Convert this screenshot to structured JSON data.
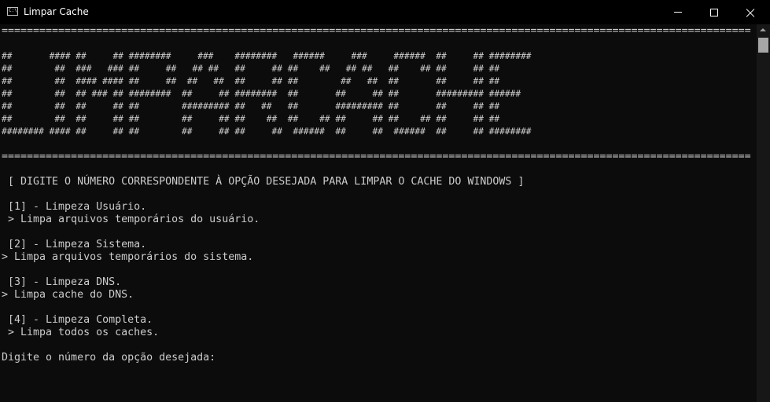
{
  "window": {
    "title": "Limpar Cache",
    "icon": "console-icon",
    "controls": {
      "minimize": "minimize-icon",
      "maximize": "maximize-icon",
      "close": "close-icon"
    }
  },
  "colors": {
    "background": "#0c0c0c",
    "text": "#cccccc",
    "titlebar": "#000000"
  },
  "console": {
    "separator_top": "=======================================================================================================================",
    "banner": [
      "##       #### ##     ## ########     ###    ########   ######     ###     ######  ##     ## ########",
      "##        ##  ###   ### ##     ##   ## ##   ##     ## ##    ##   ## ##   ##    ## ##     ## ##",
      "##        ##  #### #### ##     ##  ##   ##  ##     ## ##        ##   ##  ##       ##     ## ##",
      "##        ##  ## ### ## ########  ##     ## ########  ##       ##     ## ##       ######### ######",
      "##        ##  ##     ## ##        ######### ##   ##   ##       ######### ##       ##     ## ##",
      "##        ##  ##     ## ##        ##     ## ##    ##  ##    ## ##     ## ##    ## ##     ## ##",
      "######## #### ##     ## ##        ##     ## ##     ##  ######  ##     ##  ######  ##     ## ########"
    ],
    "separator_bottom": "=======================================================================================================================",
    "instruction": " [ DIGITE O NÚMERO CORRESPONDENTE À OPÇÃO DESEJADA PARA LIMPAR O CACHE DO WINDOWS ]",
    "options": [
      {
        "title": " [1] - Limpeza Usuário.",
        "desc": " > Limpa arquivos temporários do usuário."
      },
      {
        "title": " [2] - Limpeza Sistema.",
        "desc": "> Limpa arquivos temporários do sistema."
      },
      {
        "title": " [3] - Limpeza DNS.",
        "desc": "> Limpa cache do DNS."
      },
      {
        "title": " [4] - Limpeza Completa.",
        "desc": " > Limpa todos os caches."
      }
    ],
    "prompt": "Digite o número da opção desejada:"
  }
}
